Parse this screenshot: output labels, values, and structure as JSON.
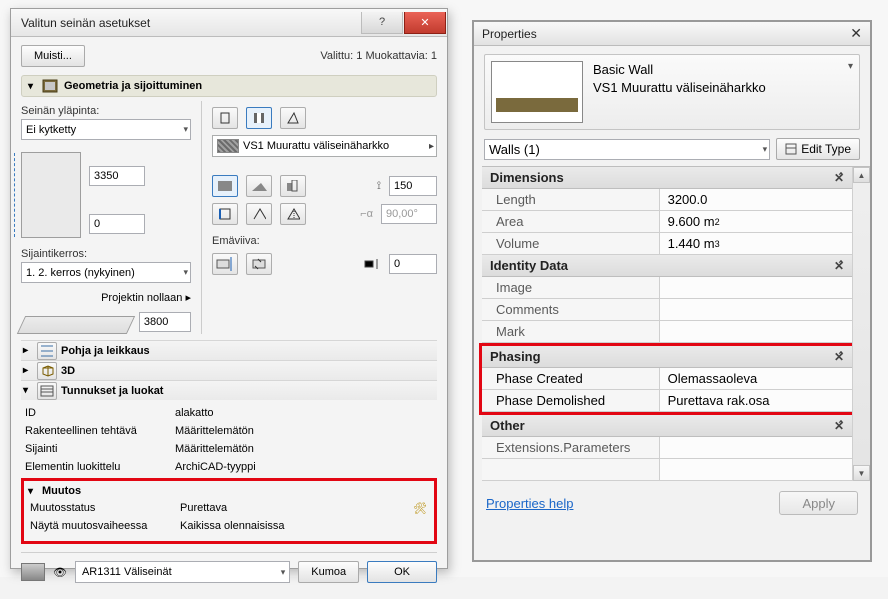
{
  "archicad": {
    "title": "Valitun seinän asetukset",
    "muisti": "Muisti...",
    "selection": "Valittu: 1 Muokattavia: 1",
    "sections": {
      "geom_title": "Geometria ja sijoittuminen",
      "top_label": "Seinän yläpinta:",
      "top_link": "Ei kytketty",
      "height": "3350",
      "base_offset": "0",
      "home_story_label": "Sijaintikerros:",
      "home_story": "1. 2. kerros (nykyinen)",
      "project_zero_label": "Projektin nollaan ▸",
      "project_zero": "3800",
      "material": "VS1 Muurattu väliseinäharkko",
      "thickness": "150",
      "angle": "90,00°",
      "refline_label": "Emäviiva:",
      "refline_offset": "0",
      "accordion": {
        "floor": "Pohja ja leikkaus",
        "threeD": "3D",
        "tags": "Tunnukset ja luokat"
      },
      "table": {
        "id_key": "ID",
        "id_val": "alakatto",
        "struct_key": "Rakenteellinen tehtävä",
        "struct_val": "Määrittelemätön",
        "pos_key": "Sijainti",
        "pos_val": "Määrittelemätön",
        "class_key": "Elementin luokittelu",
        "class_val": "ArchiCAD-tyyppi"
      },
      "muutos": {
        "header": "Muutos",
        "status_key": "Muutosstatus",
        "status_val": "Purettava",
        "show_key": "Näytä muutosvaiheessa",
        "show_val": "Kaikissa olennaisissa"
      }
    },
    "layer_eye": "👁",
    "layer": "AR1311 Väliseinät",
    "cancel": "Kumoa",
    "ok": "OK"
  },
  "revit": {
    "title": "Properties",
    "type_family": "Basic Wall",
    "type_name": "VS1 Muurattu väliseinäharkko",
    "walls_filter": "Walls (1)",
    "edit_type": "Edit Type",
    "dimensions": {
      "header": "Dimensions",
      "length_k": "Length",
      "length_v": "3200.0",
      "area_k": "Area",
      "area_v_num": "9.600 m",
      "area_exp": "2",
      "volume_k": "Volume",
      "volume_v_num": "1.440 m",
      "volume_exp": "3"
    },
    "identity": {
      "header": "Identity Data",
      "image": "Image",
      "comments": "Comments",
      "mark": "Mark"
    },
    "phasing": {
      "header": "Phasing",
      "created_k": "Phase Created",
      "created_v": "Olemassaoleva",
      "demo_k": "Phase Demolished",
      "demo_v": "Purettava rak.osa"
    },
    "other": {
      "header": "Other",
      "ext": "Extensions.Parameters"
    },
    "help": "Properties help",
    "apply": "Apply"
  }
}
